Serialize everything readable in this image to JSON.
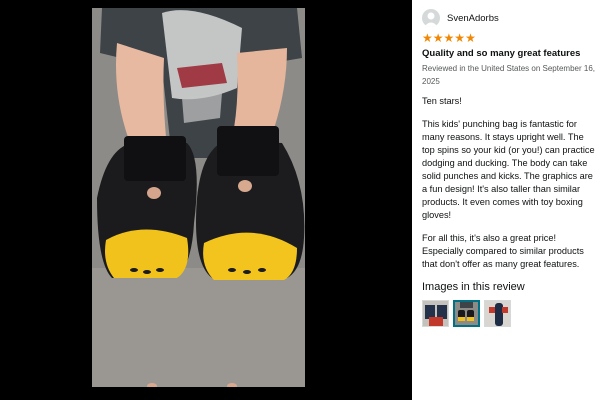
{
  "review": {
    "reviewer_name": "SvenAdorbs",
    "rating": 5,
    "title": "Quality and so many great features",
    "meta": "Reviewed in the United States on September 16, 2025",
    "paragraphs": [
      "Ten stars!",
      "This kids' punching bag is fantastic for many reasons. It stays upright well. The top spins so your kid (or you!) can practice dodging and ducking. The body can take solid punches and kicks. The graphics are a fun design! It's also taller than similar products. It even comes with toy boxing gloves!",
      "For all this, it's also a great price! Especially compared to similar products that don't offer as many great features."
    ]
  },
  "images_section": {
    "heading": "Images in this review",
    "selected_index": 1
  },
  "icons": {
    "avatar": "user-avatar-icon",
    "star": "star-icon"
  },
  "colors": {
    "star": "#f08804",
    "selected_border": "#007185",
    "viewer_bg": "#000000"
  }
}
